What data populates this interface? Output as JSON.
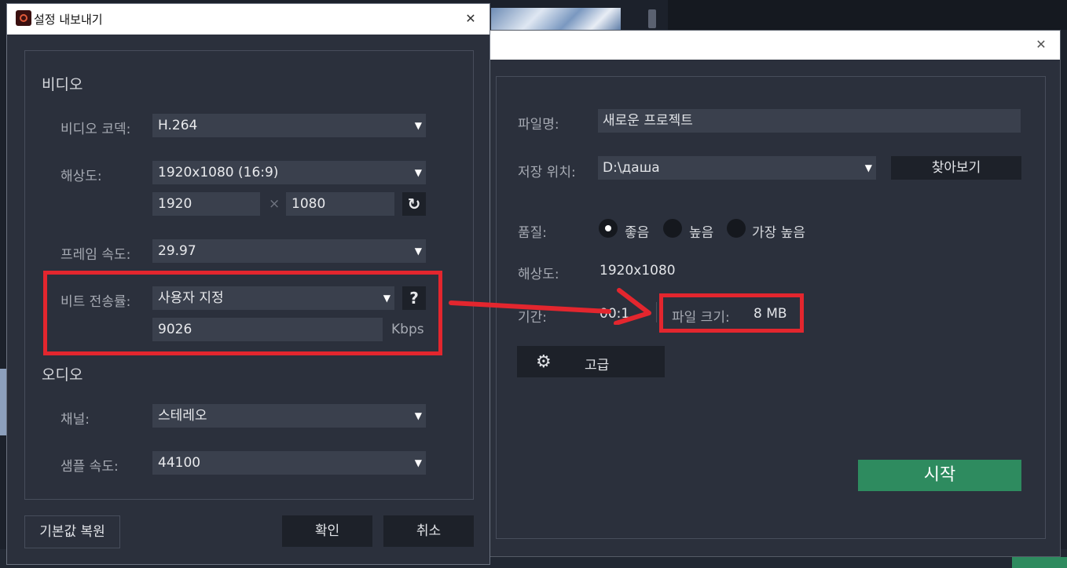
{
  "settings_dialog": {
    "title": "설정 내보내기",
    "close_glyph": "✕",
    "video": {
      "section_title": "비디오",
      "codec": {
        "label": "비디오 코덱:",
        "value": "H.264"
      },
      "resolution": {
        "label": "해상도:",
        "value": "1920x1080 (16:9)",
        "width": "1920",
        "height": "1080",
        "separator": "×",
        "link_glyph": "↻"
      },
      "frame_rate": {
        "label": "프레임 속도:",
        "value": "29.97"
      },
      "bitrate": {
        "label": "비트 전송률:",
        "value": "사용자 지정",
        "custom_value": "9026",
        "unit": "Kbps",
        "help_glyph": "?"
      }
    },
    "audio": {
      "section_title": "오디오",
      "channel": {
        "label": "채널:",
        "value": "스테레오"
      },
      "sample_rate": {
        "label": "샘플 속도:",
        "value": "44100"
      }
    },
    "footer": {
      "reset_label": "기본값 복원",
      "ok_label": "확인",
      "cancel_label": "취소"
    },
    "dropdown_glyph": "▼"
  },
  "export_window": {
    "close_glyph": "✕",
    "filename": {
      "label": "파일명:",
      "value": "새로운 프로젝트"
    },
    "save_location": {
      "label": "저장 위치:",
      "value": "D:\\даша",
      "browse_label": "찾아보기"
    },
    "quality": {
      "label": "품질:",
      "options": [
        "좋음",
        "높음",
        "가장 높음"
      ],
      "selected": "좋음"
    },
    "resolution": {
      "label": "해상도:",
      "value": "1920x1080"
    },
    "duration": {
      "label": "기간:",
      "value": "00:1"
    },
    "file_size": {
      "label": "파일 크기:",
      "value": "8 MB"
    },
    "advanced_label": "고급",
    "start_label": "시작"
  },
  "annotation_color": "#e3262e",
  "accent_green": "#2e8b5f"
}
